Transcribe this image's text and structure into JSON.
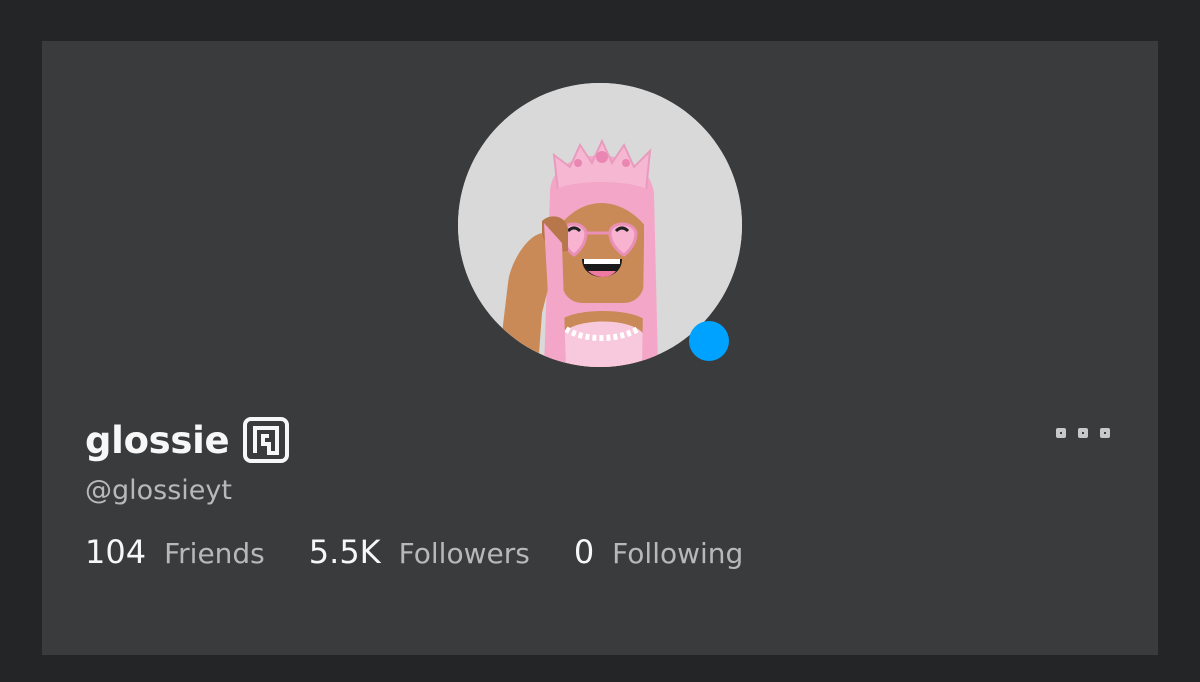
{
  "profile": {
    "display_name": "glossie",
    "username": "@glossieyt",
    "verified_icon": "verified-badge-icon",
    "avatar_icon": "avatar-headshot",
    "online_status_color": "#00a2ff"
  },
  "stats": [
    {
      "count": "104",
      "label": "Friends"
    },
    {
      "count": "5.5K",
      "label": "Followers"
    },
    {
      "count": "0",
      "label": "Following"
    }
  ],
  "actions": {
    "more_icon": "more-options-icon"
  },
  "colors": {
    "page_background": "#232527",
    "card_background": "#393b3d",
    "primary_text": "#f7f7f8",
    "secondary_text": "#b8b8b8",
    "presence": "#00a2ff"
  }
}
